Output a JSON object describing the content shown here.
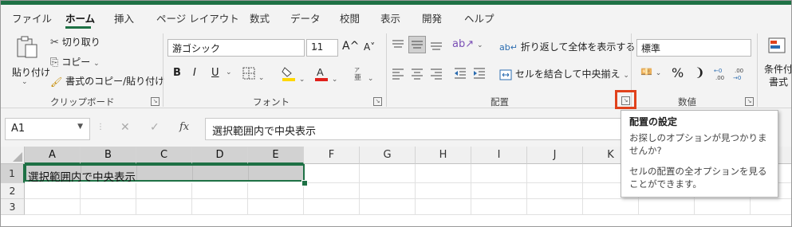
{
  "tabs": [
    "ファイル",
    "ホーム",
    "挿入",
    "ページ レイアウト",
    "数式",
    "データ",
    "校閲",
    "表示",
    "開発",
    "ヘルプ"
  ],
  "clipboard": {
    "paste": "貼り付け",
    "cut": "切り取り",
    "copy": "コピー",
    "format_painter": "書式のコピー/貼り付け",
    "label": "クリップボード"
  },
  "font": {
    "name": "游ゴシック",
    "size": "11",
    "bold": "B",
    "italic": "I",
    "underline": "U",
    "grow": "A^",
    "shrink": "A˅",
    "label": "フォント"
  },
  "alignment": {
    "wrap_text": "折り返して全体を表示する",
    "merge_center": "セルを結合して中央揃え",
    "label": "配置"
  },
  "number": {
    "format": "標準",
    "percent": "%",
    "comma": "❩",
    "label": "数値"
  },
  "styles": {
    "conditional_line1": "条件付",
    "conditional_line2": "書式"
  },
  "formula_bar": {
    "name_box": "A1",
    "cancel": "✕",
    "enter": "✓",
    "fx": "fx",
    "content": "選択範囲内で中央表示"
  },
  "columns": [
    "A",
    "B",
    "C",
    "D",
    "E",
    "F",
    "G",
    "H",
    "I",
    "J",
    "K"
  ],
  "rows": [
    "1",
    "2",
    "3"
  ],
  "cell_a1": "選択範囲内で中央表示",
  "tooltip": {
    "title": "配置の設定",
    "line1": "お探しのオプションが見つかりませんか?",
    "line2": "セルの配置の全オプションを見ることができます。"
  },
  "colors": {
    "accent": "#1e7145",
    "highlight": "#e0421c",
    "fill_yellow": "#ffd700",
    "font_red": "#e0201a"
  }
}
